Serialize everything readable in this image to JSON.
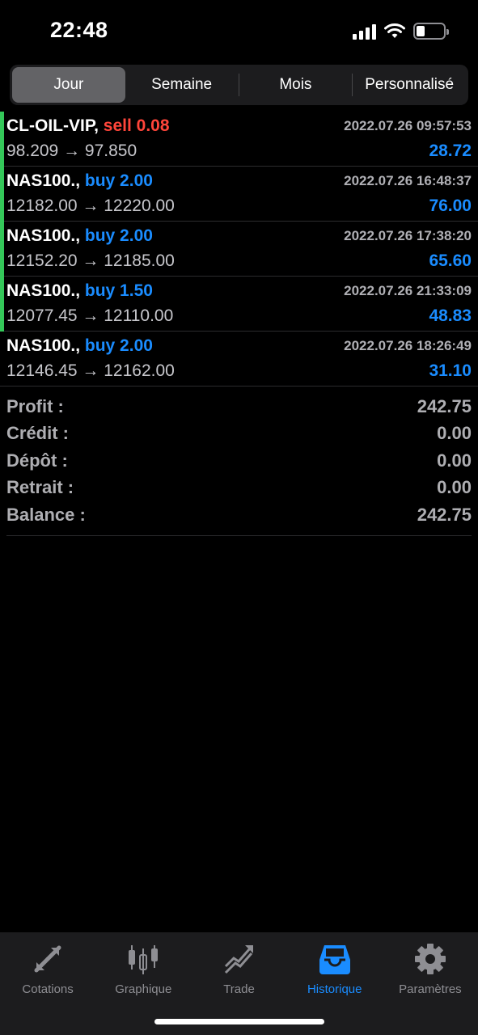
{
  "status": {
    "time": "22:48"
  },
  "tabs_top": {
    "items": [
      {
        "label": "Jour",
        "active": true
      },
      {
        "label": "Semaine",
        "active": false
      },
      {
        "label": "Mois",
        "active": false
      },
      {
        "label": "Personnalisé",
        "active": false
      }
    ]
  },
  "trades": [
    {
      "symbol": "CL-OIL-VIP,",
      "side": "sell 0.08",
      "time": "2022.07.26 09:57:53",
      "prices": "98.209 → 97.850",
      "profit": "28.72",
      "marker": true
    },
    {
      "symbol": "NAS100.,",
      "side": "buy 2.00",
      "time": "2022.07.26 16:48:37",
      "prices": "12182.00 → 12220.00",
      "profit": "76.00",
      "marker": true
    },
    {
      "symbol": "NAS100.,",
      "side": "buy 2.00",
      "time": "2022.07.26 17:38:20",
      "prices": "12152.20 → 12185.00",
      "profit": "65.60",
      "marker": true
    },
    {
      "symbol": "NAS100.,",
      "side": "buy 1.50",
      "time": "2022.07.26 21:33:09",
      "prices": "12077.45 → 12110.00",
      "profit": "48.83",
      "marker": true
    },
    {
      "symbol": "NAS100.,",
      "side": "buy 2.00",
      "time": "2022.07.26 18:26:49",
      "prices": "12146.45 → 12162.00",
      "profit": "31.10",
      "marker": false
    }
  ],
  "summary": {
    "profit_label": "Profit :",
    "profit_value": "242.75",
    "credit_label": "Crédit :",
    "credit_value": "0.00",
    "deposit_label": "Dépôt :",
    "deposit_value": "0.00",
    "withdraw_label": "Retrait :",
    "withdraw_value": "0.00",
    "balance_label": "Balance :",
    "balance_value": "242.75"
  },
  "tabbar": {
    "items": [
      {
        "label": "Cotations",
        "icon": "quotes-icon"
      },
      {
        "label": "Graphique",
        "icon": "chart-icon"
      },
      {
        "label": "Trade",
        "icon": "trade-icon"
      },
      {
        "label": "Historique",
        "icon": "history-icon",
        "active": true
      },
      {
        "label": "Paramètres",
        "icon": "settings-icon"
      }
    ]
  },
  "colors": {
    "accent": "#1a8cff",
    "sell": "#ff453a",
    "marker": "#34c759"
  }
}
